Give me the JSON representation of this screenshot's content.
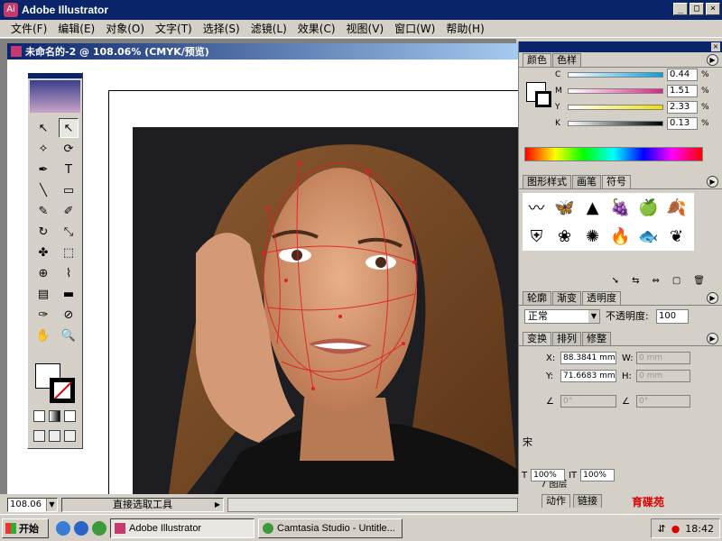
{
  "app": {
    "title": "Adobe Illustrator",
    "win_min": "_",
    "win_max": "□",
    "win_close": "×"
  },
  "menu": [
    "文件(F)",
    "编辑(E)",
    "对象(O)",
    "文字(T)",
    "选择(S)",
    "滤镜(L)",
    "效果(C)",
    "视图(V)",
    "窗口(W)",
    "帮助(H)"
  ],
  "document": {
    "title": "未命名的-2 @ 108.06% (CMYK/预览)"
  },
  "toolbox": {
    "tools": [
      "↖",
      "↖",
      "✧",
      "⟳",
      "✒",
      "T",
      "╲",
      "▭",
      "✎",
      "✐",
      "↻",
      "⤡",
      "✤",
      "⬚",
      "⊕",
      "⌇",
      "▤",
      "▬",
      "✑",
      "⊘",
      "✋",
      "🔍"
    ]
  },
  "color_panel": {
    "tabs": [
      "颜色",
      "色样"
    ],
    "channels": [
      {
        "label": "C",
        "value": "0.44",
        "color_from": "#ffffff",
        "color_to": "#00a0e0"
      },
      {
        "label": "M",
        "value": "1.51",
        "color_from": "#ffffff",
        "color_to": "#e0208a"
      },
      {
        "label": "Y",
        "value": "2.33",
        "color_from": "#ffffff",
        "color_to": "#f0e000"
      },
      {
        "label": "K",
        "value": "0.13",
        "color_from": "#ffffff",
        "color_to": "#000000"
      }
    ],
    "pct": "%"
  },
  "symbol_panel": {
    "tabs": [
      "图形样式",
      "画笔",
      "符号"
    ],
    "symbols": [
      "〰",
      "🦋",
      "▲",
      "🍇",
      "🍏",
      "🍂",
      "⛨",
      "❀",
      "✺",
      "🔥",
      "🐟",
      "❦"
    ]
  },
  "transparency_panel": {
    "tabs": [
      "轮廓",
      "渐变",
      "透明度"
    ],
    "blend_mode": "正常",
    "opacity_label": "不透明度:",
    "opacity_value": "100"
  },
  "transform_panel": {
    "tabs": [
      "变换",
      "排列",
      "修整"
    ],
    "x_label": "X:",
    "x_value": "88.3841 mm",
    "y_label": "Y:",
    "y_value": "71.6683 mm",
    "w_label": "W:",
    "w_value": "0 mm",
    "h_label": "H:",
    "h_value": "0 mm",
    "rotate_value": "0°",
    "shear_value": "0°"
  },
  "layers_panel": {
    "label": "7 图层",
    "top_char": "宋"
  },
  "bottom_tabs": [
    "动作",
    "链接"
  ],
  "char_zoom": [
    "100%",
    "100%"
  ],
  "status": {
    "zoom": "108.06",
    "tool": "直接选取工具"
  },
  "watermark": "育碟苑",
  "taskbar": {
    "start": "开始",
    "tasks": [
      "Adobe Illustrator",
      "Camtasia Studio - Untitle..."
    ],
    "clock": "18:42"
  }
}
